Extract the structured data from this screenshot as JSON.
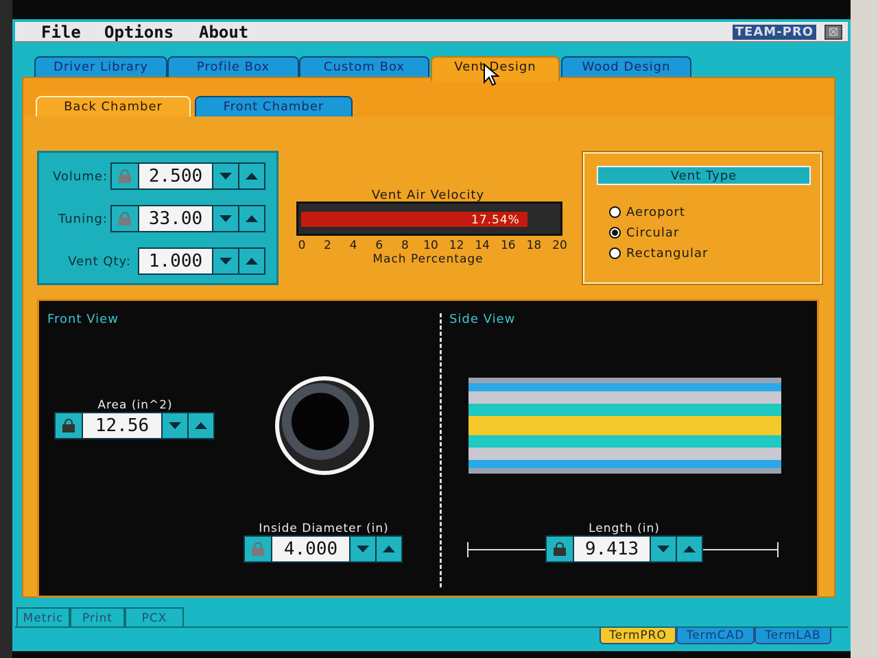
{
  "menu": {
    "file": "File",
    "options": "Options",
    "about": "About",
    "brand": "TEAM-PRO",
    "close": "⊠"
  },
  "main_tabs": [
    {
      "label": "Driver Library"
    },
    {
      "label": "Profile Box"
    },
    {
      "label": "Custom Box"
    },
    {
      "label": "Vent Design"
    },
    {
      "label": "Wood Design"
    }
  ],
  "active_main_tab": "Vent Design",
  "sub_tabs": [
    {
      "label": "Back Chamber"
    },
    {
      "label": "Front Chamber"
    }
  ],
  "active_sub_tab": "Back Chamber",
  "params": {
    "volume": {
      "label": "Volume:",
      "value": "2.500",
      "locked": true
    },
    "tuning": {
      "label": "Tuning:",
      "value": "33.00",
      "locked": true
    },
    "vent_qty": {
      "label": "Vent Qty:",
      "value": "1.000",
      "locked": false
    }
  },
  "velocity": {
    "title": "Vent Air Velocity",
    "value_text": "17.54%",
    "percent": 17.54,
    "max": 20,
    "ticks": [
      "0",
      "2",
      "4",
      "6",
      "8",
      "10",
      "12",
      "14",
      "16",
      "18",
      "20"
    ],
    "axis_label": "Mach Percentage",
    "bar_color": "#c41a10"
  },
  "vent_type": {
    "title": "Vent Type",
    "options": [
      {
        "label": "Aeroport",
        "checked": false
      },
      {
        "label": "Circular",
        "checked": true
      },
      {
        "label": "Rectangular",
        "checked": false
      }
    ]
  },
  "front_view": {
    "label": "Front View",
    "area": {
      "caption": "Area (in^2)",
      "value": "12.56",
      "locked": false
    },
    "inside_diameter": {
      "caption": "Inside Diameter (in)",
      "value": "4.000",
      "locked": true
    }
  },
  "side_view": {
    "label": "Side View",
    "length": {
      "caption": "Length (in)",
      "value": "9.413",
      "locked": false
    }
  },
  "bottom_buttons": [
    {
      "label": "Metric"
    },
    {
      "label": "Print"
    },
    {
      "label": "PCX"
    }
  ],
  "app_tabs": [
    {
      "label": "TermPRO"
    },
    {
      "label": "TermCAD"
    },
    {
      "label": "TermLAB"
    }
  ],
  "active_app_tab": "TermPRO",
  "colors": {
    "accent_orange": "#f0a322",
    "teal": "#1ab8c4",
    "tab_blue": "#1a98d8"
  }
}
